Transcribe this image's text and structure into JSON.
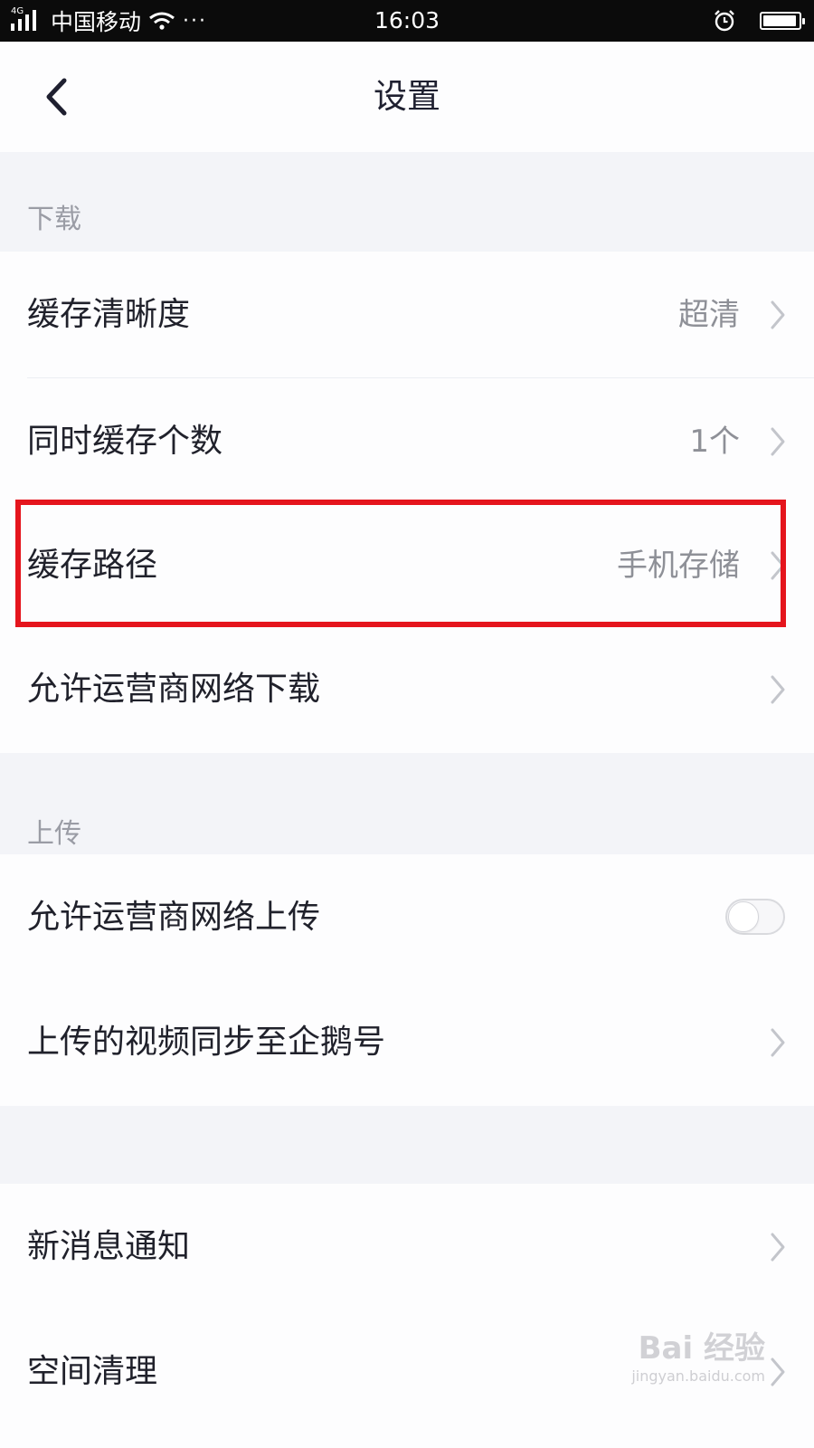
{
  "status_bar": {
    "network": "4G",
    "carrier": "中国移动",
    "dots": "···",
    "time": "16:03",
    "battery_level": 0.95
  },
  "nav": {
    "title": "设置"
  },
  "sections": {
    "download": {
      "header": "下载",
      "rows": [
        {
          "label": "缓存清晰度",
          "value": "超清"
        },
        {
          "label": "同时缓存个数",
          "value": "1个"
        },
        {
          "label": "缓存路径",
          "value": "手机存储"
        },
        {
          "label": "允许运营商网络下载",
          "value": ""
        }
      ]
    },
    "upload": {
      "header": "上传",
      "rows": [
        {
          "label": "允许运营商网络上传",
          "toggle_on": false
        },
        {
          "label": "上传的视频同步至企鹅号",
          "value": ""
        }
      ]
    },
    "other": {
      "rows": [
        {
          "label": "新消息通知"
        },
        {
          "label": "空间清理"
        }
      ]
    }
  },
  "annotation": {
    "highlight_color": "#e5151d"
  },
  "watermark": {
    "logo": "Bai 经验",
    "url": "jingyan.baidu.com"
  },
  "colors": {
    "background": "#f3f4f8",
    "row_background": "#fdfdfe",
    "text_primary": "#20212b",
    "text_secondary": "#8e9097",
    "section_header": "#9a9ca5"
  }
}
